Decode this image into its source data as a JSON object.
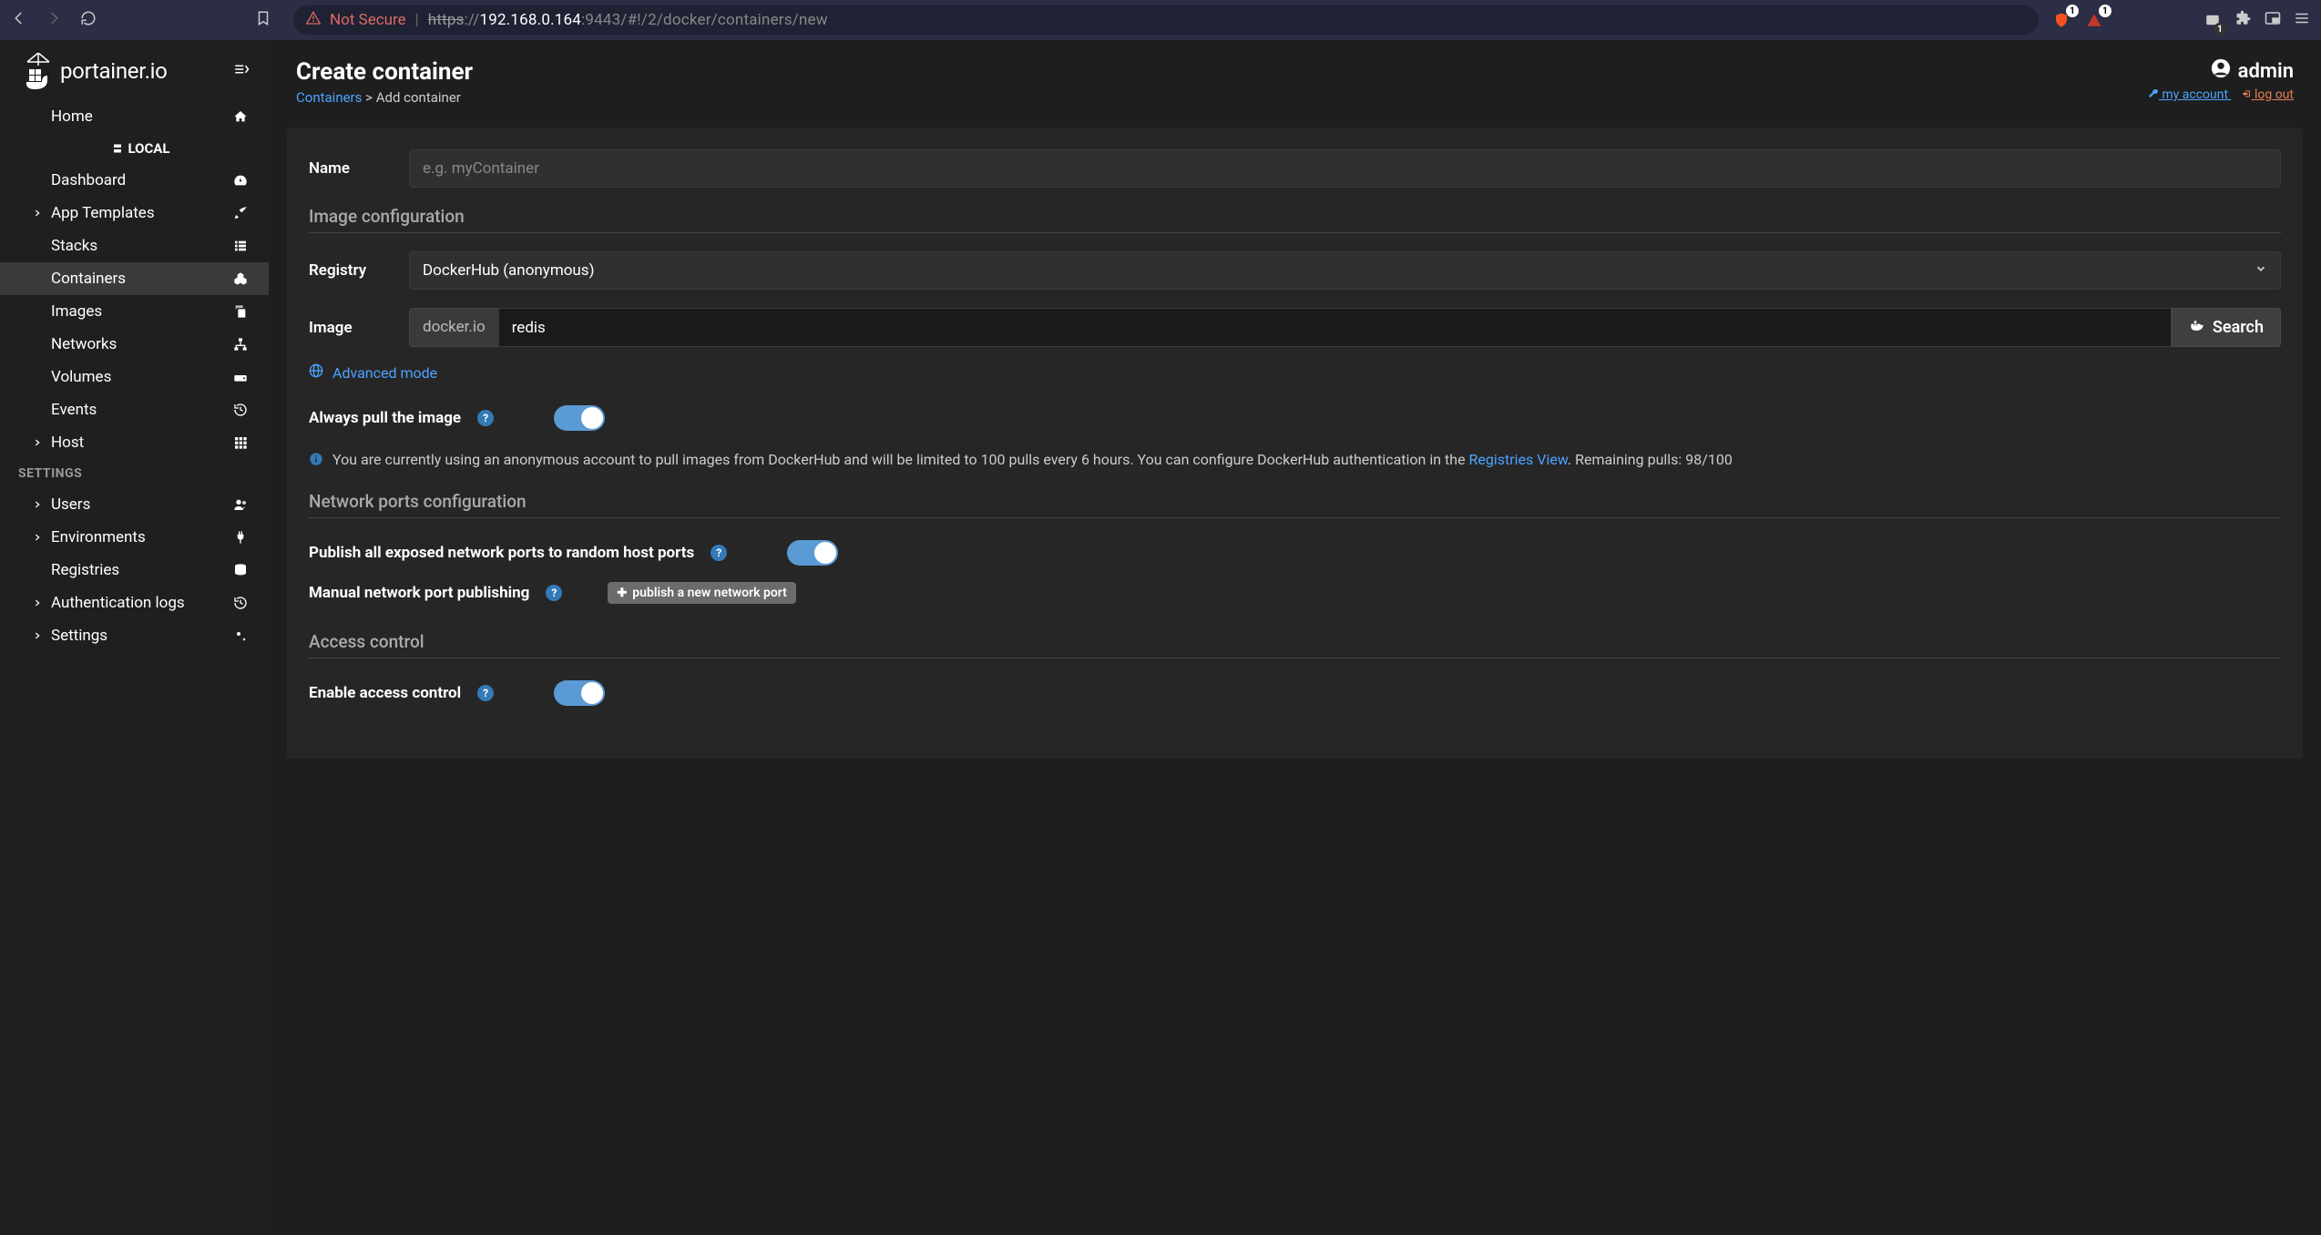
{
  "browser": {
    "not_secure": "Not Secure",
    "url_scheme": "https",
    "url_host": "192.168.0.164",
    "url_port": ":9443",
    "url_path": "/#!/2/docker/containers/new",
    "badge1": "1",
    "badge2": "1",
    "badge3": "1"
  },
  "brand": "portainer.io",
  "sidebar": {
    "local_label": "LOCAL",
    "items": [
      {
        "label": "Home",
        "chev": false,
        "icon": "home"
      },
      {
        "label": "Dashboard",
        "chev": false,
        "icon": "gauge"
      },
      {
        "label": "App Templates",
        "chev": true,
        "icon": "rocket"
      },
      {
        "label": "Stacks",
        "chev": false,
        "icon": "list"
      },
      {
        "label": "Containers",
        "chev": false,
        "icon": "cubes",
        "active": true
      },
      {
        "label": "Images",
        "chev": false,
        "icon": "copy"
      },
      {
        "label": "Networks",
        "chev": false,
        "icon": "sitemap"
      },
      {
        "label": "Volumes",
        "chev": false,
        "icon": "hdd"
      },
      {
        "label": "Events",
        "chev": false,
        "icon": "history"
      },
      {
        "label": "Host",
        "chev": true,
        "icon": "grid"
      }
    ],
    "settings_header": "SETTINGS",
    "settings": [
      {
        "label": "Users",
        "chev": true,
        "icon": "users"
      },
      {
        "label": "Environments",
        "chev": true,
        "icon": "plug"
      },
      {
        "label": "Registries",
        "chev": false,
        "icon": "database"
      },
      {
        "label": "Authentication logs",
        "chev": true,
        "icon": "history"
      },
      {
        "label": "Settings",
        "chev": true,
        "icon": "cogs"
      }
    ]
  },
  "header": {
    "title": "Create container",
    "bc_link": "Containers",
    "bc_current": "Add container",
    "username": "admin",
    "my_account": " my account ",
    "log_out": " log out"
  },
  "form": {
    "name_label": "Name",
    "name_placeholder": "e.g. myContainer",
    "section_image": "Image configuration",
    "registry_label": "Registry",
    "registry_value": "DockerHub (anonymous)",
    "image_label": "Image",
    "image_prefix": "docker.io",
    "image_value": "redis",
    "search_btn": "Search",
    "advanced": "Advanced mode",
    "always_pull_label": "Always pull the image",
    "info_text_1": "You are currently using an anonymous account to pull images from DockerHub and will be limited to 100 pulls every 6 hours. You can configure DockerHub authentication in the ",
    "info_link": "Registries View",
    "info_text_2": ". Remaining pulls: 98/100",
    "section_network": "Network ports configuration",
    "publish_all_label": "Publish all exposed network ports to random host ports",
    "manual_label": "Manual network port publishing",
    "publish_btn": "publish a new network port",
    "section_access": "Access control",
    "enable_access_label": "Enable access control"
  }
}
